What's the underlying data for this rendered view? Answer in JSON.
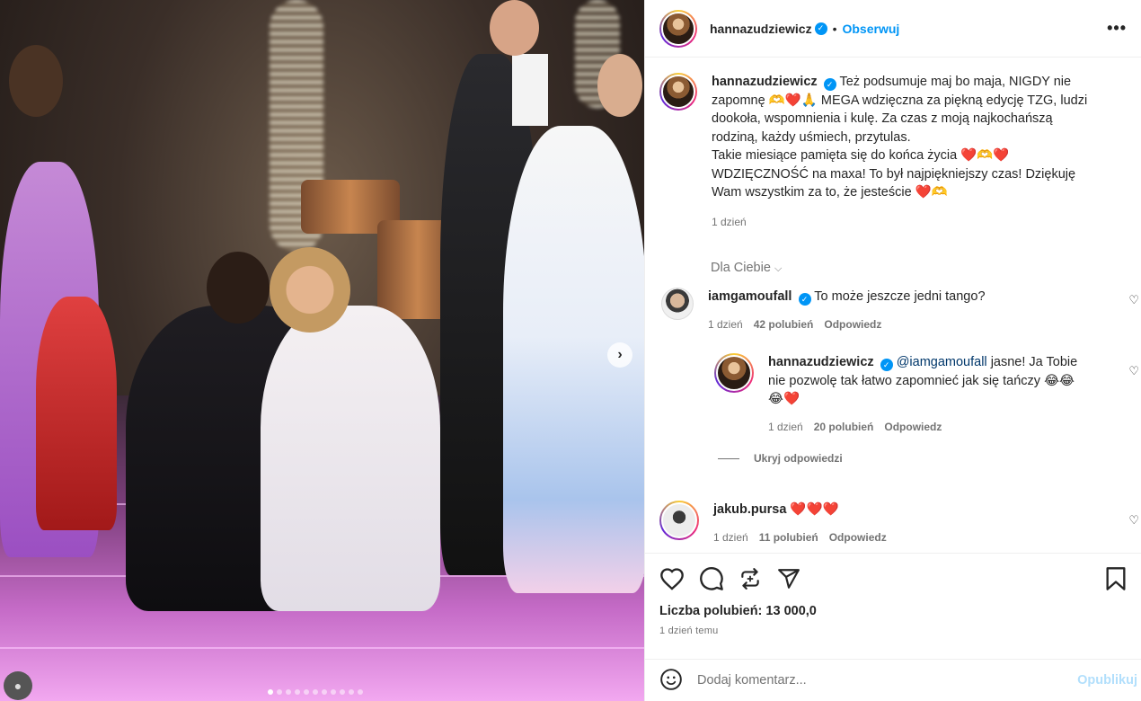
{
  "post": {
    "author": "hannazudziewicz",
    "follow_label": "Obserwuj",
    "more_label": "•••",
    "caption_lines": [
      "Też podsumuje maj bo maja, NIGDY nie",
      "zapomnę 🫶❤️🙏 MEGA wdzięczna za piękną edycję TZG, ludzi",
      "dookoła, wspomnienia i kulę. Za czas z moją najkochańszą",
      "rodziną, każdy uśmiech, przytulas.",
      "Takie miesiące pamięta się do końca życia ❤️🫶❤️",
      "WDZIĘCZNOŚĆ na maxa! To był najpiękniejszy czas! Dziękuję",
      "Wam wszystkim za to, że jesteście ❤️🫶"
    ],
    "caption_time": "1 dzień",
    "for_you_label": "Dla Ciebie"
  },
  "comments": [
    {
      "user": "iamgamoufall",
      "text": "To może jeszcze jedni tango?",
      "time": "1 dzień",
      "likes": "42 polubień",
      "reply_label": "Odpowiedz"
    },
    {
      "user": "hannazudziewicz",
      "mention": "@iamgamoufall",
      "text_line1": " jasne! Ja Tobie",
      "text_line2": "nie pozwolę tak łatwo zapomnieć jak się tańczy 😂😂",
      "text_line3": "😂❤️",
      "time": "1 dzień",
      "likes": "20 polubień",
      "reply_label": "Odpowiedz",
      "hide_replies_label": "Ukryj odpowiedzi"
    },
    {
      "user": "jakub.pursa",
      "text": "❤️❤️❤️",
      "time": "1 dzień",
      "likes": "11 polubień",
      "reply_label": "Odpowiedz"
    }
  ],
  "footer": {
    "likes": "Liczba polubień: 13 000,0",
    "ago": "1 dzień temu",
    "add_comment_placeholder": "Dodaj komentarz...",
    "publish_label": "Opublikuj"
  },
  "carousel": {
    "total": 11,
    "current": 1
  },
  "colors": {
    "accent": "#0095f6",
    "text": "#262626",
    "muted": "#737373"
  }
}
